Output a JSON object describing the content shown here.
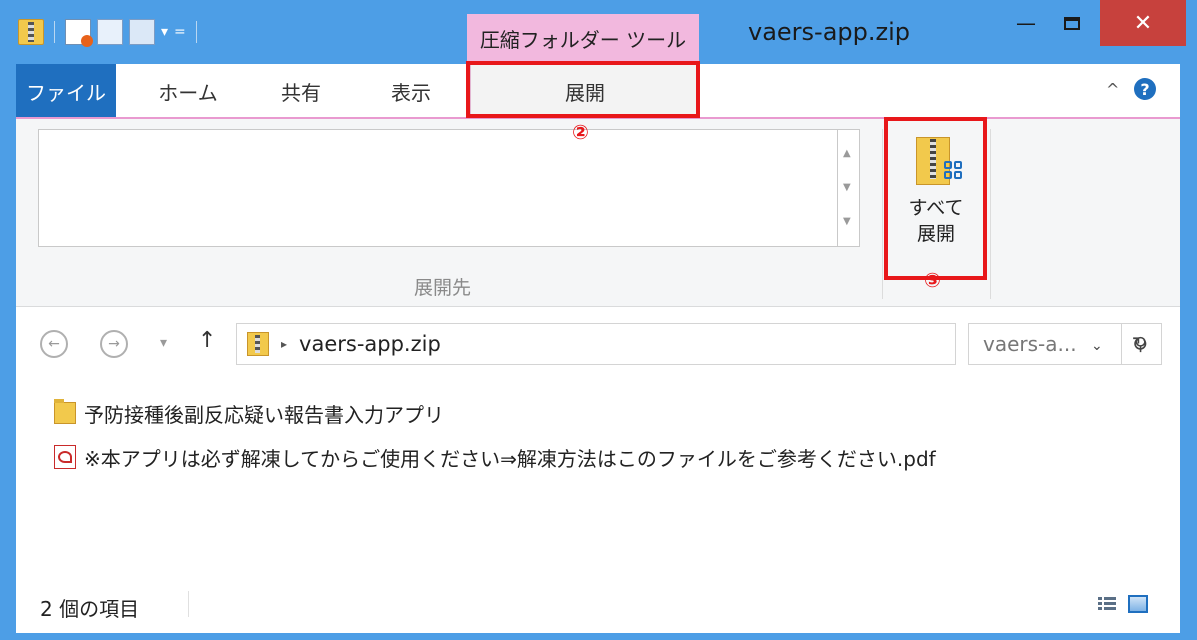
{
  "window": {
    "context_tab_label": "圧縮フォルダー ツール",
    "title": "vaers-app.zip",
    "minimize_glyph": "—",
    "close_glyph": "✕",
    "qat_dropdown_glyph": "▾",
    "qat_customize_glyph": "="
  },
  "ribbon": {
    "tabs": [
      "ファイル",
      "ホーム",
      "共有",
      "表示",
      "展開"
    ],
    "active_tab": "展開",
    "collapse_glyph": "^",
    "help_glyph": "?",
    "extract_to_group_label": "展開先",
    "extract_all_label_line1": "すべて",
    "extract_all_label_line2": "展開"
  },
  "annotations": [
    {
      "number": "②",
      "target": "tab-extract"
    },
    {
      "number": "③",
      "target": "extract-all-button"
    }
  ],
  "address_bar": {
    "path_text": "vaers-app.zip",
    "path_separator": "▸",
    "search_placeholder": "vaers-a...",
    "dropdown_glyph": "⌄",
    "refresh_glyph": "↻",
    "back_glyph": "←",
    "forward_glyph": "→",
    "recent_glyph": "▾",
    "up_glyph": "↑",
    "search_glyph": "⚲"
  },
  "files": [
    {
      "name": "予防接種後副反応疑い報告書入力アプリ",
      "type": "folder"
    },
    {
      "name": "※本アプリは必ず解凍してからご使用ください⇒解凍方法はこのファイルをご参考ください.pdf",
      "type": "pdf"
    }
  ],
  "status": {
    "item_count_text": "2 個の項目"
  },
  "icons": [
    "zip-folder-icon",
    "properties-icon",
    "new-folder-icon",
    "pages-icon",
    "minimize-icon",
    "maximize-icon",
    "close-icon",
    "help-icon",
    "back-icon",
    "forward-icon",
    "up-icon",
    "refresh-icon",
    "search-icon",
    "folder-icon",
    "pdf-icon",
    "details-view-icon",
    "large-icons-view-icon"
  ],
  "colors": {
    "window_frame": "#4d9ee6",
    "file_tab": "#1f6fbf",
    "context_tab": "#f2b8de",
    "close_button": "#c7413d",
    "callout": "#e8171a"
  }
}
